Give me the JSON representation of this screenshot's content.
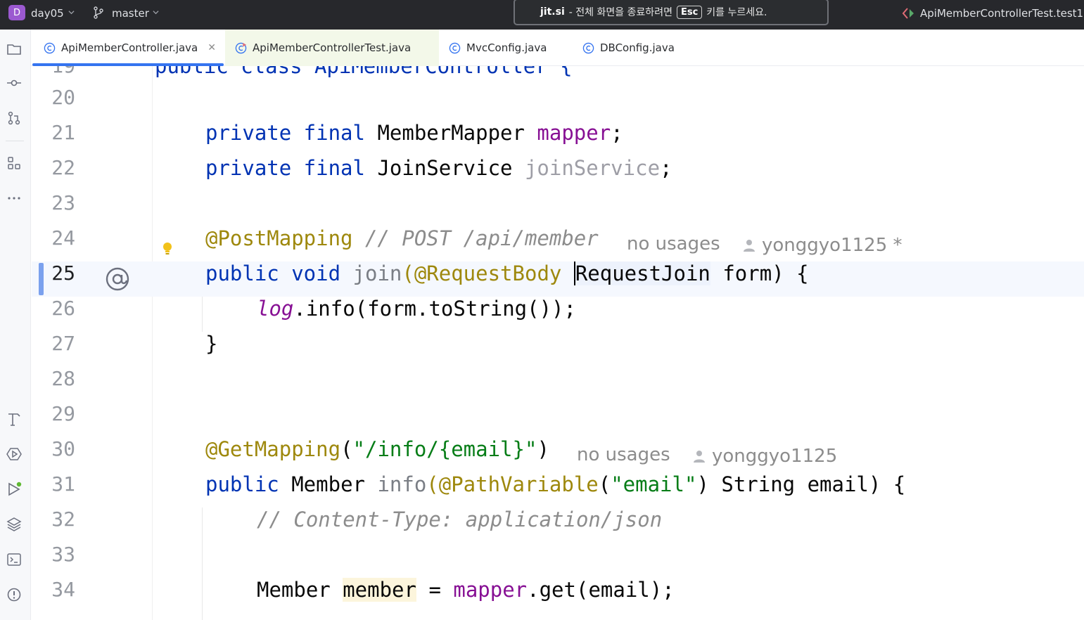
{
  "titlebar": {
    "project_badge": "D",
    "project_name": "day05",
    "branch_name": "master",
    "esc_banner": {
      "site": "jit.si",
      "text_before": "- 전체 화면을 종료하려면",
      "key": "Esc",
      "text_after": "키를 누르세요."
    },
    "run_config": "ApiMemberControllerTest.test1"
  },
  "tabs": [
    {
      "label": "ApiMemberController.java",
      "active": true,
      "closable": true
    },
    {
      "label": "ApiMemberControllerTest.java",
      "active": false,
      "test": true
    },
    {
      "label": "MvcConfig.java",
      "active": false
    },
    {
      "label": "DBConfig.java",
      "active": false
    }
  ],
  "tool_icons": [
    "folder-icon",
    "commit-icon",
    "pull-requests-icon",
    "structure-icon",
    "more-icon",
    "build-icon",
    "services-icon",
    "run-icon",
    "layers-icon",
    "terminal-icon",
    "problems-icon"
  ],
  "editor": {
    "partial_line": {
      "number": "19",
      "text": "public class ApiMemberController {"
    },
    "lines": [
      {
        "number": "20"
      },
      {
        "number": "21",
        "t1": "private final",
        "t2": " MemberMapper ",
        "t3": "mapper",
        "t4": ";"
      },
      {
        "number": "22",
        "t1": "private final",
        "t2": " JoinService ",
        "t3": "joinService",
        "t4": ";"
      },
      {
        "number": "23"
      },
      {
        "number": "24",
        "anno": "@PostMapping",
        "comment": " // POST /api/member",
        "hint_usages": "no usages",
        "hint_author": "yonggyo1125 *"
      },
      {
        "number": "25",
        "kw": "public void",
        "fn": " join",
        "p1": "(",
        "anno": "@RequestBody",
        "sp": " ",
        "type": "RequestJoin",
        "rest": " form) {"
      },
      {
        "number": "26",
        "field": "log",
        "rest": ".info(form.toString());"
      },
      {
        "number": "27",
        "text": "}"
      },
      {
        "number": "28"
      },
      {
        "number": "29"
      },
      {
        "number": "30",
        "anno": "@GetMapping",
        "p1": "(",
        "str": "\"/info/{email}\"",
        "p2": ")",
        "hint_usages": "no usages",
        "hint_author": "yonggyo1125"
      },
      {
        "number": "31",
        "kw": "public",
        "t2": " Member ",
        "fn": "info",
        "p1": "(",
        "anno": "@PathVariable",
        "p2": "(",
        "str": "\"email\"",
        "rest": ") String email) {"
      },
      {
        "number": "32",
        "comment": "// Content-Type: application/json"
      },
      {
        "number": "33"
      },
      {
        "number": "34",
        "t1": "Member ",
        "var": "member",
        "t2": " = ",
        "field": "mapper",
        "rest": ".get(email);"
      }
    ]
  },
  "colors": {
    "keyword": "#0033b3",
    "annotation": "#9e880d",
    "string": "#067d17",
    "field": "#871094",
    "comment": "#8c8c8c",
    "accent": "#3574f0"
  }
}
